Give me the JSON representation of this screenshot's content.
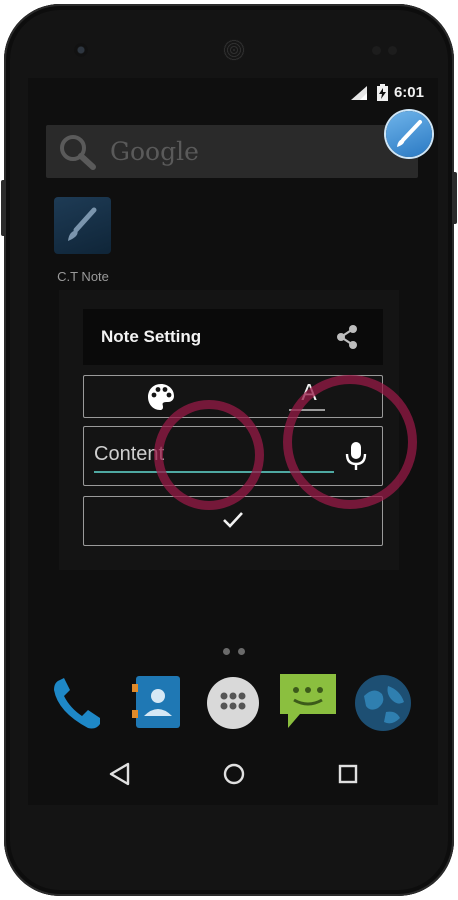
{
  "status_bar": {
    "time": "6:01"
  },
  "search": {
    "placeholder": "Google"
  },
  "app": {
    "label": "C.T Note"
  },
  "dialog": {
    "title": "Note Setting",
    "font_glyph": "A",
    "content_placeholder": "Content"
  },
  "icons": {
    "share": "share-icon",
    "palette": "palette-icon",
    "font": "font-format-icon",
    "mic": "microphone-icon",
    "confirm": "check-icon",
    "search": "search-icon",
    "back": "back-triangle-icon",
    "home": "home-circle-icon",
    "recents": "recents-square-icon"
  },
  "dock": [
    "phone-icon",
    "contacts-icon",
    "app-drawer-icon",
    "messaging-icon",
    "browser-icon"
  ],
  "colors": {
    "accent_underline": "#4fa9a2",
    "touch_ring": "#961946",
    "floating_app": "#3a8fd8"
  }
}
